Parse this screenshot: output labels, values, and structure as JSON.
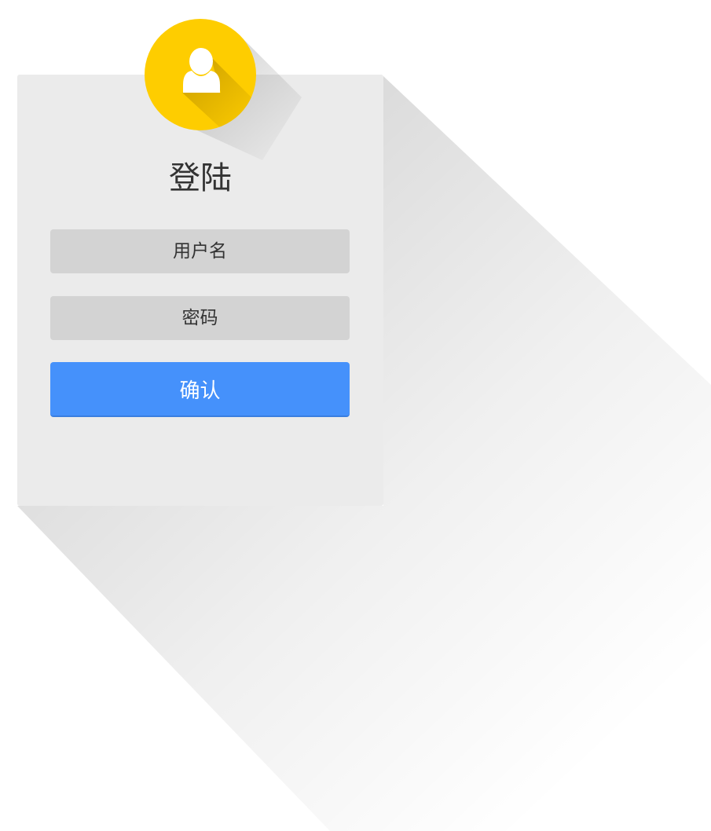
{
  "login": {
    "title": "登陆",
    "username_placeholder": "用户名",
    "password_placeholder": "密码",
    "confirm_label": "确认"
  },
  "icons": {
    "avatar": "user-icon"
  },
  "colors": {
    "avatar_bg": "#fecd00",
    "confirm_bg": "#4591fb",
    "card_bg": "#ebebeb",
    "field_bg": "#d3d3d3"
  }
}
